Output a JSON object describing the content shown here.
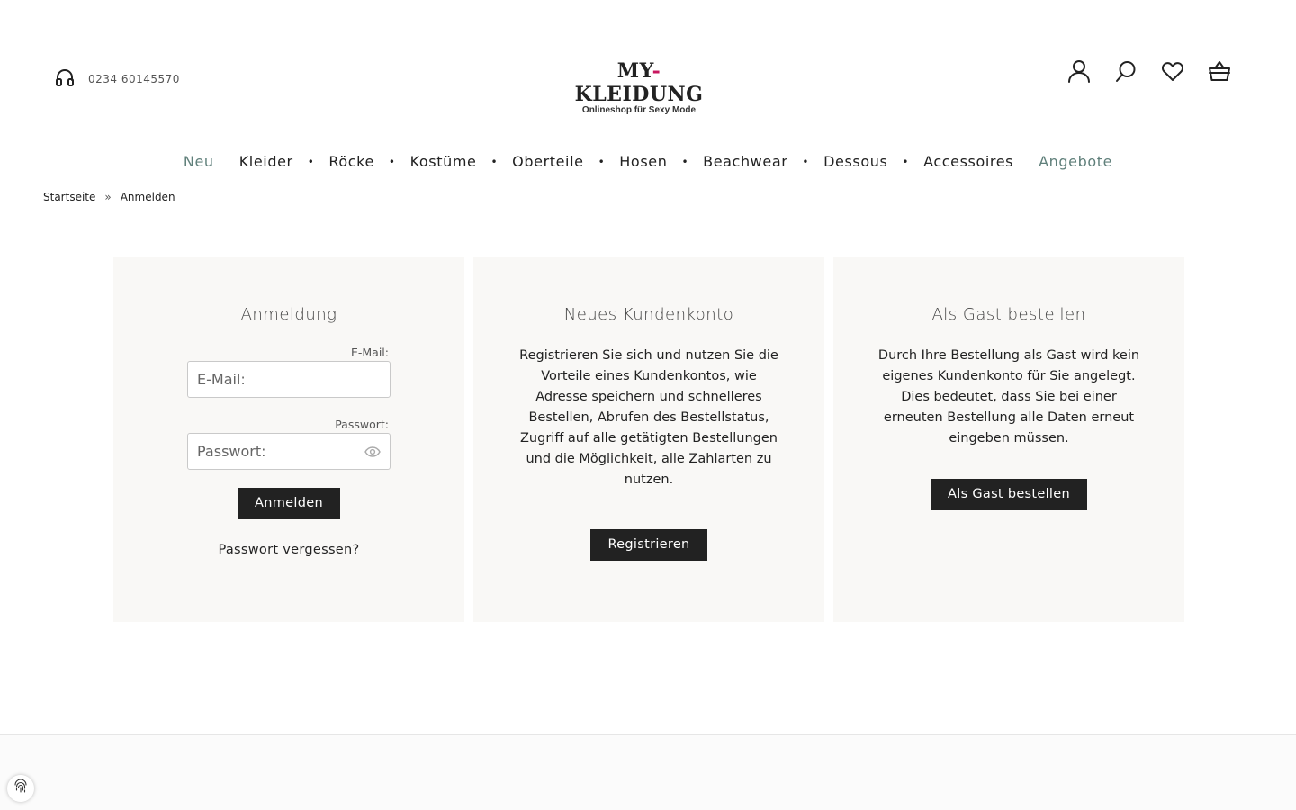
{
  "header": {
    "phone_icon": "headset-icon",
    "phone_number": "0234 60145570",
    "logo_prefix": "MY",
    "logo_dash": "-",
    "logo_rest": "KLEIDUNG",
    "logo_tagline": "Onlineshop für Sexy Mode",
    "icons": [
      "user-icon",
      "search-icon",
      "heart-icon",
      "basket-icon"
    ],
    "accent_color": "#c8175f"
  },
  "nav": {
    "items": [
      {
        "label": "Neu",
        "highlight": true,
        "dropdown": false
      },
      {
        "label": "Kleider",
        "highlight": false,
        "dropdown": true
      },
      {
        "label": "Röcke",
        "highlight": false,
        "dropdown": true
      },
      {
        "label": "Kostüme",
        "highlight": false,
        "dropdown": true
      },
      {
        "label": "Oberteile",
        "highlight": false,
        "dropdown": true
      },
      {
        "label": "Hosen",
        "highlight": false,
        "dropdown": true
      },
      {
        "label": "Beachwear",
        "highlight": false,
        "dropdown": true
      },
      {
        "label": "Dessous",
        "highlight": false,
        "dropdown": true
      },
      {
        "label": "Accessoires",
        "highlight": false,
        "dropdown": false
      },
      {
        "label": "Angebote",
        "highlight": true,
        "dropdown": false
      }
    ],
    "dropdown_marker": "•",
    "highlight_color": "#5f7f7a"
  },
  "breadcrumb": {
    "home": "Startseite",
    "separator": "»",
    "current": "Anmelden"
  },
  "login": {
    "title": "Anmeldung",
    "email_label": "E-Mail:",
    "email_placeholder": "E-Mail:",
    "email_value": "",
    "password_label": "Passwort:",
    "password_placeholder": "Passwort:",
    "password_value": "",
    "submit_label": "Anmelden",
    "forgot_label": "Passwort vergessen?"
  },
  "register": {
    "title": "Neues Kundenkonto",
    "text": "Registrieren Sie sich und nutzen Sie die Vorteile eines Kundenkontos, wie Adresse speichern und schnelleres Bestellen, Abrufen des Bestellstatus, Zugriff auf alle getätigten Bestellungen und die Möglichkeit, alle Zahlarten zu nutzen.",
    "button_label": "Registrieren"
  },
  "guest": {
    "title": "Als Gast bestellen",
    "text": "Durch Ihre Bestellung als Gast wird kein eigenes Kundenkonto für Sie angelegt. Dies bedeutet, dass Sie bei einer erneuten Bestellung alle Daten erneut eingeben müssen.",
    "button_label": "Als Gast bestellen"
  },
  "footer": {
    "cookie_icon": "fingerprint-icon"
  }
}
